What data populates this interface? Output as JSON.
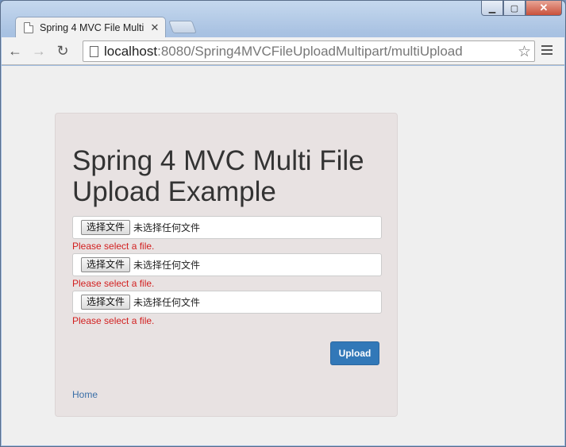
{
  "browser": {
    "tab_title": "Spring 4 MVC File Multi",
    "tab_close": "✕",
    "url_host": "localhost",
    "url_rest": ":8080/Spring4MVCFileUploadMultipart/multiUpload",
    "back_icon": "←",
    "forward_icon": "→",
    "reload_icon": "↻",
    "star_icon": "☆",
    "min_icon": "▁",
    "max_icon": "▢",
    "close_icon": "✕"
  },
  "page": {
    "heading": "Spring 4 MVC Multi File Upload Example",
    "files": [
      {
        "button_label": "选择文件",
        "status": "未选择任何文件",
        "error": "Please select a file."
      },
      {
        "button_label": "选择文件",
        "status": "未选择任何文件",
        "error": "Please select a file."
      },
      {
        "button_label": "选择文件",
        "status": "未选择任何文件",
        "error": "Please select a file."
      }
    ],
    "upload_label": "Upload",
    "home_label": "Home"
  },
  "colors": {
    "error": "#d22020",
    "primary_button": "#3278b8",
    "link": "#3a6fa8"
  }
}
